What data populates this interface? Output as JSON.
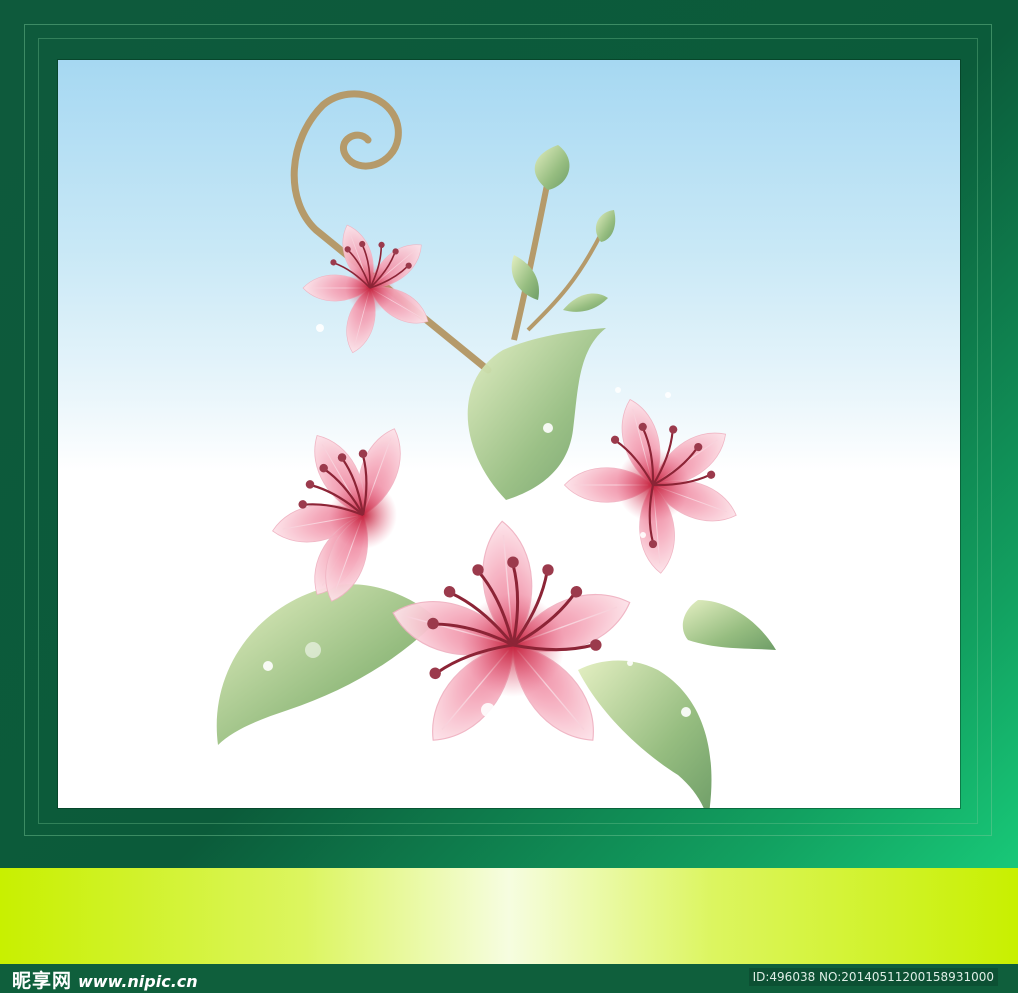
{
  "watermark": {
    "logo": "昵享网",
    "url": "www.nipic.cn",
    "id": "ID:496038 NO:20140511200158931000"
  },
  "colors": {
    "frame": "#0e5a3c",
    "band": "#c8f000",
    "petal": "#f4a6b8",
    "leaf": "#8fb879",
    "stamen": "#9a2a3a"
  }
}
